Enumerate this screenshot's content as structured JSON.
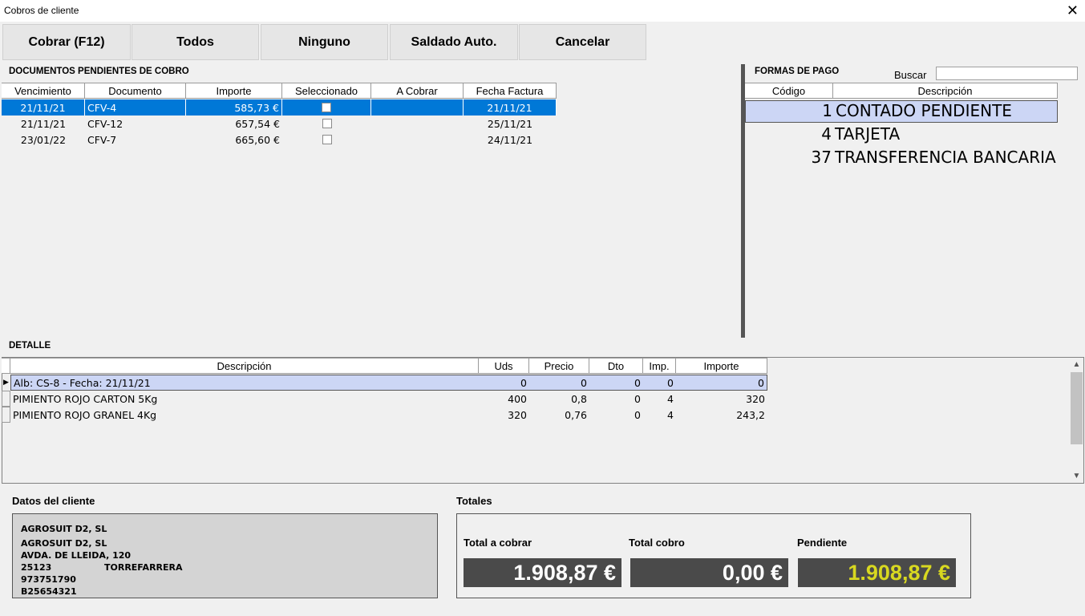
{
  "window": {
    "title": "Cobros de cliente",
    "close_glyph": "✕"
  },
  "toolbar": {
    "buttons": [
      {
        "label": "Cobrar (F12)"
      },
      {
        "label": "Todos"
      },
      {
        "label": "Ninguno"
      },
      {
        "label": "Saldado Auto."
      },
      {
        "label": "Cancelar"
      }
    ]
  },
  "pending": {
    "title": "DOCUMENTOS PENDIENTES DE COBRO",
    "columns": [
      "Vencimiento",
      "Documento",
      "Importe",
      "Seleccionado",
      "A Cobrar",
      "Fecha Factura"
    ],
    "rows": [
      {
        "vencimiento": "21/11/21",
        "documento": "CFV-4",
        "importe": "585,73 €",
        "seleccionado": false,
        "a_cobrar": "",
        "fecha_factura": "21/11/21",
        "selected_row": true
      },
      {
        "vencimiento": "21/11/21",
        "documento": "CFV-12",
        "importe": "657,54 €",
        "seleccionado": false,
        "a_cobrar": "",
        "fecha_factura": "25/11/21",
        "selected_row": false
      },
      {
        "vencimiento": "23/01/22",
        "documento": "CFV-7",
        "importe": "665,60 €",
        "seleccionado": false,
        "a_cobrar": "",
        "fecha_factura": "24/11/21",
        "selected_row": false
      }
    ]
  },
  "payment_methods": {
    "title": "FORMAS DE PAGO",
    "search_label": "Buscar",
    "search_value": "",
    "columns": [
      "Código",
      "Descripción"
    ],
    "rows": [
      {
        "code": "1",
        "description": "CONTADO PENDIENTE",
        "selected": true
      },
      {
        "code": "4",
        "description": "TARJETA",
        "selected": false
      },
      {
        "code": "37",
        "description": "TRANSFERENCIA BANCARIA",
        "selected": false
      }
    ]
  },
  "detail": {
    "title": "DETALLE",
    "columns": [
      "Descripción",
      "Uds",
      "Precio",
      "Dto",
      "Imp.",
      "Importe"
    ],
    "rows": [
      {
        "descripcion": "Alb: CS-8  - Fecha: 21/11/21",
        "uds": "0",
        "precio": "0",
        "dto": "0",
        "imp": "0",
        "importe": "0",
        "current": true
      },
      {
        "descripcion": "PIMIENTO ROJO CARTON 5Kg",
        "uds": "400",
        "precio": "0,8",
        "dto": "0",
        "imp": "4",
        "importe": "320",
        "current": false
      },
      {
        "descripcion": "PIMIENTO ROJO GRANEL 4Kg",
        "uds": "320",
        "precio": "0,76",
        "dto": "0",
        "imp": "4",
        "importe": "243,2",
        "current": false
      }
    ]
  },
  "client": {
    "title": "Datos del cliente",
    "line1": "AGROSUIT D2, SL",
    "line2": "AGROSUIT D2, SL",
    "address": "AVDA. DE LLEIDA, 120",
    "postal_code": "25123",
    "city": "TORREFARRERA",
    "phone": "973751790",
    "tax_id": "B25654321"
  },
  "totals": {
    "title": "Totales",
    "total_a_cobrar_label": "Total a cobrar",
    "total_a_cobrar": "1.908,87 €",
    "total_cobro_label": "Total cobro",
    "total_cobro": "0,00 €",
    "pendiente_label": "Pendiente",
    "pendiente": "1.908,87 €",
    "pendiente_color": "#d8d820"
  }
}
